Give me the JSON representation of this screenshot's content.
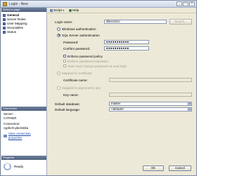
{
  "window": {
    "title": "Login - New"
  },
  "left": {
    "header": "Select a page",
    "pages": [
      {
        "label": "General",
        "selected": true
      },
      {
        "label": "Server Roles",
        "selected": false
      },
      {
        "label": "User Mapping",
        "selected": false
      },
      {
        "label": "Securables",
        "selected": false
      },
      {
        "label": "Status",
        "selected": false
      }
    ],
    "connection": {
      "header": "Connection",
      "server_label": "Server:",
      "server_value": "CYPHER",
      "conn_label": "Connection:",
      "conn_value": "cypher\\cyberistika",
      "view_link": "View connection properties"
    },
    "progress": {
      "header": "Progress",
      "status": "Ready"
    }
  },
  "toolbar": {
    "script": "Script",
    "help": "Help"
  },
  "form": {
    "login_name_label": "Login name:",
    "login_name_value": "sikecorico",
    "search_button": "Search...",
    "windows_auth": "Windows authentication",
    "sql_auth": "SQL Server authentication",
    "password_label": "Password:",
    "password_value": "●●●●●●●●●●●",
    "confirm_label": "Confirm password:",
    "confirm_value": "●●●●●●●●●●●",
    "enforce_policy": "Enforce password policy",
    "enforce_expiration": "Enforce password expiration",
    "must_change": "User must change password at next login",
    "mapped_cert": "Mapped to certificate",
    "cert_name_label": "Certificate name:",
    "mapped_key": "Mapped to asymmetric key",
    "key_name_label": "Key name:",
    "default_db_label": "Default database:",
    "default_db_value": "master",
    "default_lang_label": "Default language:",
    "default_lang_value": "<default>"
  },
  "buttons": {
    "ok": "OK",
    "cancel": "Cancel"
  }
}
